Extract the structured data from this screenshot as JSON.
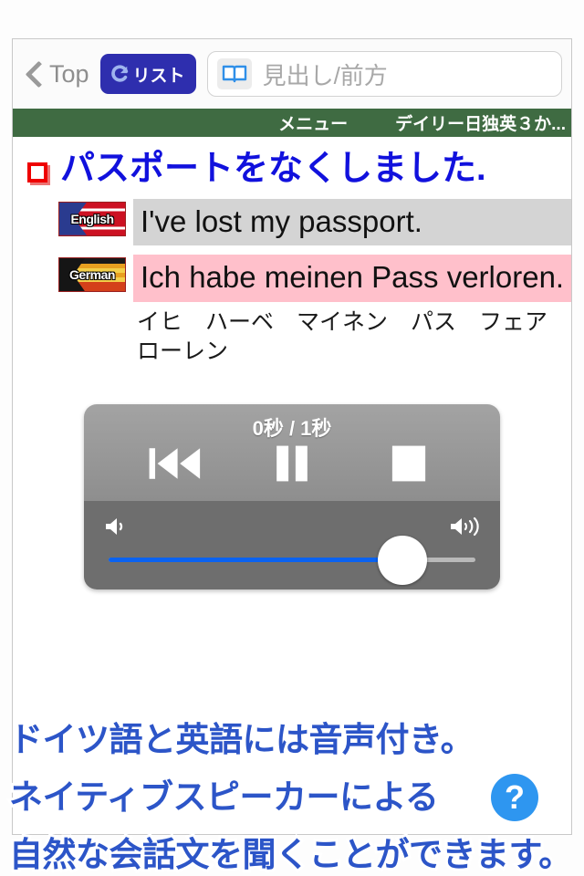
{
  "toolbar": {
    "back_label": "Top",
    "back_icon": "chevron-left-icon",
    "list_button_label": "リスト",
    "list_button_icon": "loop-arrow-icon",
    "search_icon": "open-book-icon",
    "search_value": "",
    "search_placeholder": "見出し/前方"
  },
  "green_bar": {
    "menu_label": "メニュー",
    "title_label": "デイリー日独英３か..."
  },
  "entry": {
    "checkbox_icon": "red-checkbox-icon",
    "headword": "パスポートをなくしました.",
    "translations": [
      {
        "flag_label": "English",
        "flag_icon": "english-flag-icon",
        "text": "I've lost my passport.",
        "background": "#d4d4d4"
      },
      {
        "flag_label": "German",
        "flag_icon": "german-flag-icon",
        "text": "Ich habe meinen Pass verloren.",
        "background": "#ffc0cb"
      }
    ],
    "reading": "イヒ　ハーベ　マイネン　パス　フェアローレン"
  },
  "player": {
    "time_display": "0秒 / 1秒",
    "rewind_icon": "rewind-icon",
    "pause_icon": "pause-icon",
    "stop_icon": "stop-icon",
    "volume_low_icon": "speaker-low-icon",
    "volume_high_icon": "speaker-high-icon",
    "volume_percent": 80,
    "fill_color": "#0a62f0"
  },
  "captions": {
    "line1": "ドイツ語と英語には音声付き。",
    "line2": "ネイティブスピーカーによる",
    "line3": "自然な会話文を聞くことができます。",
    "color": "#2c55c8"
  },
  "help": {
    "label": "?",
    "icon": "help-circle-icon",
    "color": "#2e96f0"
  }
}
